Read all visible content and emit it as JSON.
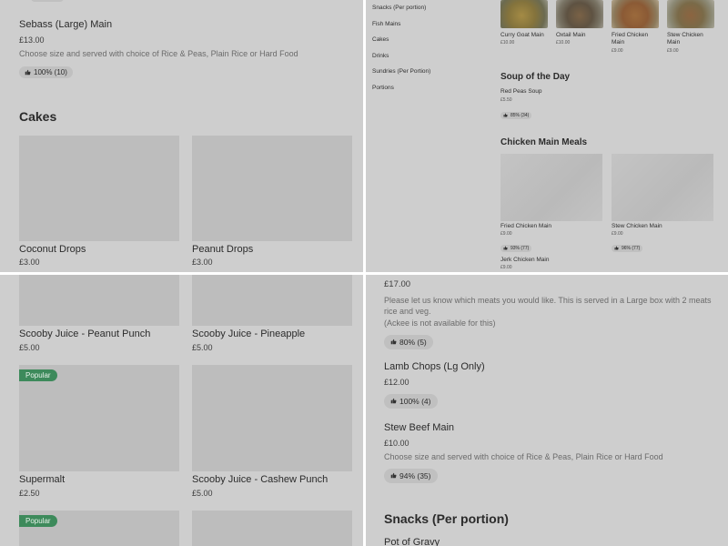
{
  "top_left": {
    "item": {
      "name": "Sebass (Large) Main",
      "price": "£13.00",
      "desc": "Choose size and served with choice of Rice & Peas, Plain Rice or Hard Food",
      "rating": "100% (10)"
    },
    "section_title": "Cakes",
    "cards": [
      {
        "name": "Coconut Drops",
        "price": "£3.00"
      },
      {
        "name": "Peanut Drops",
        "price": "£3.00"
      }
    ]
  },
  "top_right": {
    "nav": [
      "Snacks (Per portion)",
      "Fish Mains",
      "Cakes",
      "Drinks",
      "Sundries (Per Portion)",
      "Portions"
    ],
    "top_cards": [
      {
        "name": "Curry Goat Main",
        "price": "£10.00"
      },
      {
        "name": "Oxtail Main",
        "price": "£10.00"
      },
      {
        "name": "Fried Chicken Main",
        "price": "£9.00"
      },
      {
        "name": "Stew Chicken Main",
        "price": "£9.00"
      }
    ],
    "soup": {
      "title": "Soup of the Day",
      "name": "Red Peas Soup",
      "price": "£5.50",
      "rating": "85% (34)"
    },
    "chicken": {
      "title": "Chicken Main Meals",
      "cards": [
        {
          "name": "Fried Chicken Main",
          "price": "£9.00",
          "rating": "93% (77)"
        },
        {
          "name": "Stew Chicken Main",
          "price": "£9.00",
          "rating": "96% (77)"
        }
      ],
      "next": {
        "name": "Jerk Chicken Main",
        "price": "£9.00"
      }
    }
  },
  "bottom_left": {
    "cards": [
      {
        "name": "Scooby Juice - Peanut Punch",
        "price": "£5.00"
      },
      {
        "name": "Scooby Juice - Pineapple",
        "price": "£5.00"
      },
      {
        "name": "Supermalt",
        "price": "£2.50",
        "badge": "Popular"
      },
      {
        "name": "Scooby Juice - Cashew Punch",
        "price": "£5.00"
      }
    ],
    "next_badge": "Popular"
  },
  "bottom_right": {
    "item1": {
      "price": "£17.00",
      "desc1": "Please let us know which meats you would like. This is served in a Large box with 2 meats rice and veg.",
      "desc2": "(Ackee is not available for this)",
      "rating": "80% (5)"
    },
    "item2": {
      "name": "Lamb Chops (Lg Only)",
      "price": "£12.00",
      "rating": "100% (4)"
    },
    "item3": {
      "name": "Stew Beef Main",
      "price": "£10.00",
      "desc": "Choose size and served with choice of Rice & Peas, Plain Rice or Hard Food",
      "rating": "94% (35)"
    },
    "section_title": "Snacks (Per portion)",
    "next_item": "Pot of Gravy"
  },
  "colors": {
    "background": "#cecece",
    "divider": "#ffffff",
    "badge": "#3d8a5b",
    "pill": "#c0c0c0"
  },
  "icons": [
    "thumbs-up-icon"
  ]
}
